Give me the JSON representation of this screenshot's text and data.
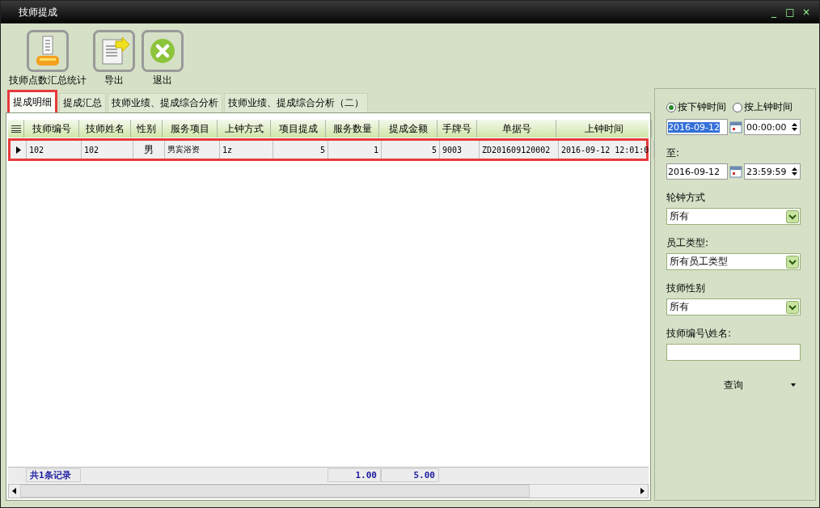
{
  "window": {
    "title": "技师提成",
    "controls": [
      "_",
      "□",
      "×"
    ]
  },
  "toolbar": [
    {
      "label": "技师点数汇总统计",
      "kind": "stats"
    },
    {
      "label": "导出",
      "kind": "export"
    },
    {
      "label": "退出",
      "kind": "exit"
    }
  ],
  "tabs": [
    {
      "label": "提成明细",
      "selected": true,
      "marked": true
    },
    {
      "label": "提成汇总",
      "selected": false,
      "marked": false
    },
    {
      "label": "技师业绩、提成综合分析",
      "selected": false,
      "marked": false
    },
    {
      "label": "技师业绩、提成综合分析（二）",
      "selected": false,
      "marked": false
    }
  ],
  "table": {
    "columns": [
      {
        "label": "技师编号",
        "kind": "text"
      },
      {
        "label": "技师姓名",
        "kind": "text"
      },
      {
        "label": "性别",
        "kind": "center"
      },
      {
        "label": "服务项目",
        "kind": "text"
      },
      {
        "label": "上钟方式",
        "kind": "text"
      },
      {
        "label": "项目提成",
        "kind": "number"
      },
      {
        "label": "服务数量",
        "kind": "number",
        "total": "1.00"
      },
      {
        "label": "提成金额",
        "kind": "number",
        "total": "5.00"
      },
      {
        "label": "手牌号",
        "kind": "text"
      },
      {
        "label": "单据号",
        "kind": "text"
      },
      {
        "label": "上钟时间",
        "kind": "text"
      }
    ],
    "rows": [
      {
        "current": true,
        "marked": true,
        "cells": [
          "102",
          "102",
          "男",
          "男宾浴资",
          "1z",
          "5",
          "1",
          "5",
          "9003",
          "ZD201609120002",
          "2016-09-12 12:01:0"
        ]
      }
    ],
    "footer": {
      "count": "共1条记录"
    }
  },
  "filters": {
    "radios": [
      {
        "label": "按下钟时间",
        "selected": true
      },
      {
        "label": "按上钟时间",
        "selected": false
      }
    ],
    "from": {
      "date": "2016-09-12",
      "time": "00:00:00",
      "date_selected": true
    },
    "to_label": "至:",
    "to": {
      "date": "2016-09-12",
      "time": "23:59:59",
      "date_selected": false
    },
    "selects": [
      {
        "label": "轮钟方式",
        "value": "所有"
      },
      {
        "label": "员工类型:",
        "value": "所有员工类型"
      },
      {
        "label": "技师性别",
        "value": "所有"
      }
    ],
    "search": {
      "label": "技师编号\\姓名:"
    },
    "query_button": "查询"
  }
}
